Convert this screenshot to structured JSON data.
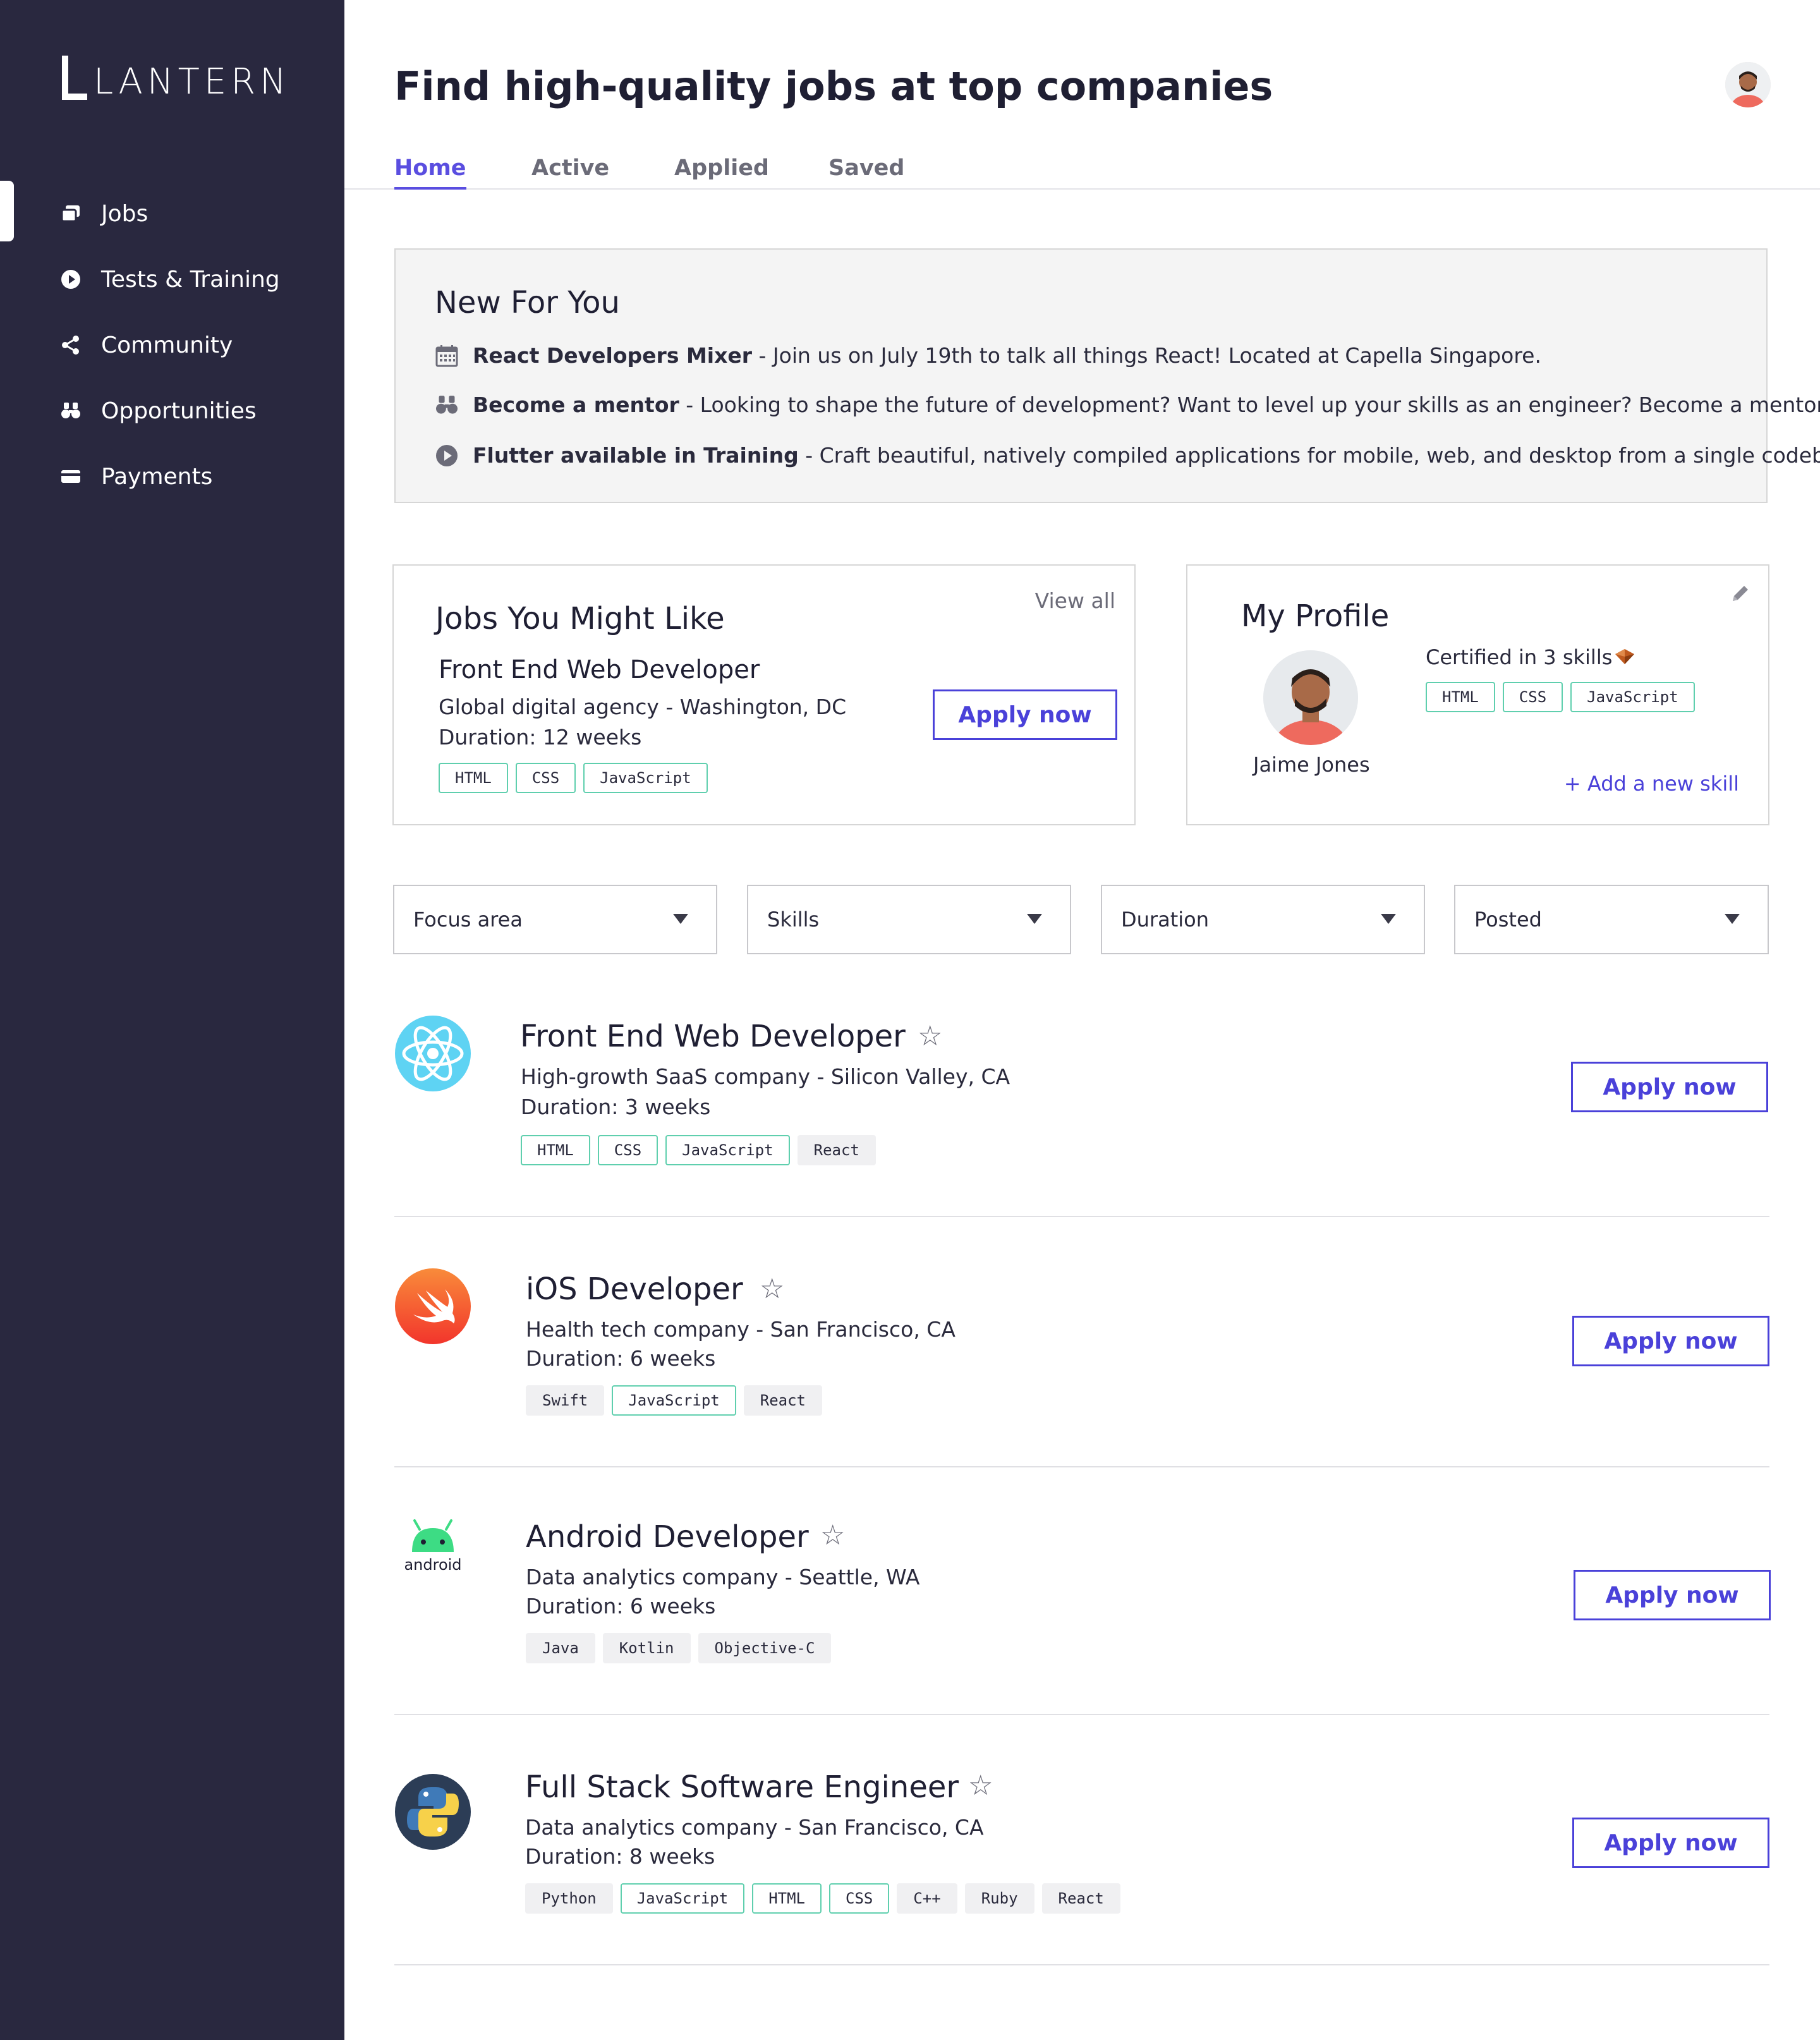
{
  "brand": {
    "name": "LANTERN"
  },
  "sidebar": {
    "items": [
      {
        "label": "Jobs",
        "icon": "jobs-icon"
      },
      {
        "label": "Tests & Training",
        "icon": "play-icon"
      },
      {
        "label": "Community",
        "icon": "share-icon"
      },
      {
        "label": "Opportunities",
        "icon": "binoculars-icon"
      },
      {
        "label": "Payments",
        "icon": "card-icon"
      }
    ],
    "active_index": 0
  },
  "header": {
    "title": "Find high-quality jobs at top companies"
  },
  "tabs": [
    {
      "label": "Home"
    },
    {
      "label": "Active"
    },
    {
      "label": "Applied"
    },
    {
      "label": "Saved"
    }
  ],
  "new_for_you": {
    "title": "New For You",
    "items": [
      {
        "icon": "calendar-icon",
        "bold": "React Developers Mixer",
        "text": " - Join us on July 19th to talk all things React! Located at Capella Singapore."
      },
      {
        "icon": "binoculars-icon",
        "bold": "Become a mentor",
        "text": " - Looking to shape the future of development? Want to level up your skills as an engineer? Become a mentor!"
      },
      {
        "icon": "play-circle-icon",
        "bold": "Flutter available in Training",
        "text": " - Craft beautiful, natively compiled applications for mobile, web, and desktop from a single codebase."
      }
    ]
  },
  "jobs_you_might_like": {
    "title": "Jobs You Might Like",
    "view_all": "View all",
    "job": {
      "title": "Front End Web Developer",
      "company": "Global digital agency - Washington, DC",
      "duration": "Duration: 12 weeks",
      "tags": [
        "HTML",
        "CSS",
        "JavaScript"
      ]
    },
    "apply_label": "Apply now"
  },
  "my_profile": {
    "title": "My Profile",
    "name": "Jaime Jones",
    "certified": "Certified in 3 skills",
    "skills": [
      "HTML",
      "CSS",
      "JavaScript"
    ],
    "add_skill": "+ Add a new skill"
  },
  "filters": [
    {
      "label": "Focus area"
    },
    {
      "label": "Skills"
    },
    {
      "label": "Duration"
    },
    {
      "label": "Posted"
    }
  ],
  "listings": [
    {
      "logo": "react-logo",
      "title": "Front End Web Developer",
      "company": "High-growth SaaS company - Silicon Valley, CA",
      "duration": "Duration: 3 weeks",
      "tags": [
        {
          "label": "HTML",
          "certified": true
        },
        {
          "label": "CSS",
          "certified": true
        },
        {
          "label": "JavaScript",
          "certified": true
        },
        {
          "label": "React",
          "certified": false
        }
      ],
      "apply_label": "Apply now"
    },
    {
      "logo": "swift-logo",
      "title": "iOS Developer",
      "company": "Health tech company - San Francisco, CA",
      "duration": "Duration: 6 weeks",
      "tags": [
        {
          "label": "Swift",
          "certified": false
        },
        {
          "label": "JavaScript",
          "certified": true
        },
        {
          "label": "React",
          "certified": false
        }
      ],
      "apply_label": "Apply now"
    },
    {
      "logo": "android-logo",
      "logo_text": "android",
      "title": "Android Developer",
      "company": "Data analytics company - Seattle, WA",
      "duration": "Duration: 6 weeks",
      "tags": [
        {
          "label": "Java",
          "certified": false
        },
        {
          "label": "Kotlin",
          "certified": false
        },
        {
          "label": "Objective-C",
          "certified": false
        }
      ],
      "apply_label": "Apply now"
    },
    {
      "logo": "python-logo",
      "title": "Full Stack Software Engineer",
      "company": "Data analytics company - San Francisco, CA",
      "duration": "Duration: 8 weeks",
      "tags": [
        {
          "label": "Python",
          "certified": false
        },
        {
          "label": "JavaScript",
          "certified": true
        },
        {
          "label": "HTML",
          "certified": true
        },
        {
          "label": "CSS",
          "certified": true
        },
        {
          "label": "C++",
          "certified": false
        },
        {
          "label": "Ruby",
          "certified": false
        },
        {
          "label": "React",
          "certified": false
        }
      ],
      "apply_label": "Apply now"
    }
  ],
  "colors": {
    "sidebar": "#29283f",
    "accent": "#4a41d9",
    "cert_border": "#5fcfae"
  }
}
